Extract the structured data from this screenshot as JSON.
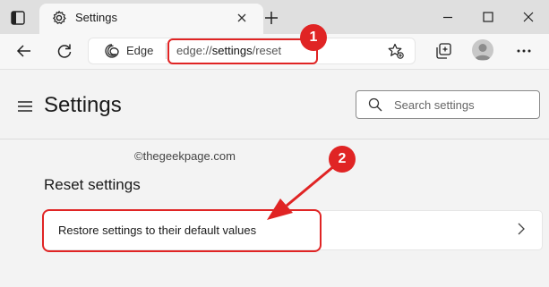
{
  "tab": {
    "title": "Settings"
  },
  "toolbar": {
    "site_label": "Edge",
    "url_scheme": "edge://",
    "url_host": "settings",
    "url_path": "/reset"
  },
  "settings_header": {
    "title": "Settings",
    "search_placeholder": "Search settings"
  },
  "content": {
    "watermark": "©thegeekpage.com",
    "section_title": "Reset settings",
    "items": [
      {
        "label": "Restore settings to their default values"
      }
    ]
  },
  "annotations": {
    "step1": "1",
    "step2": "2"
  },
  "colors": {
    "annotation_red": "#e02424",
    "tabstrip_bg": "#dfdfdf",
    "page_bg": "#f3f3f3"
  }
}
